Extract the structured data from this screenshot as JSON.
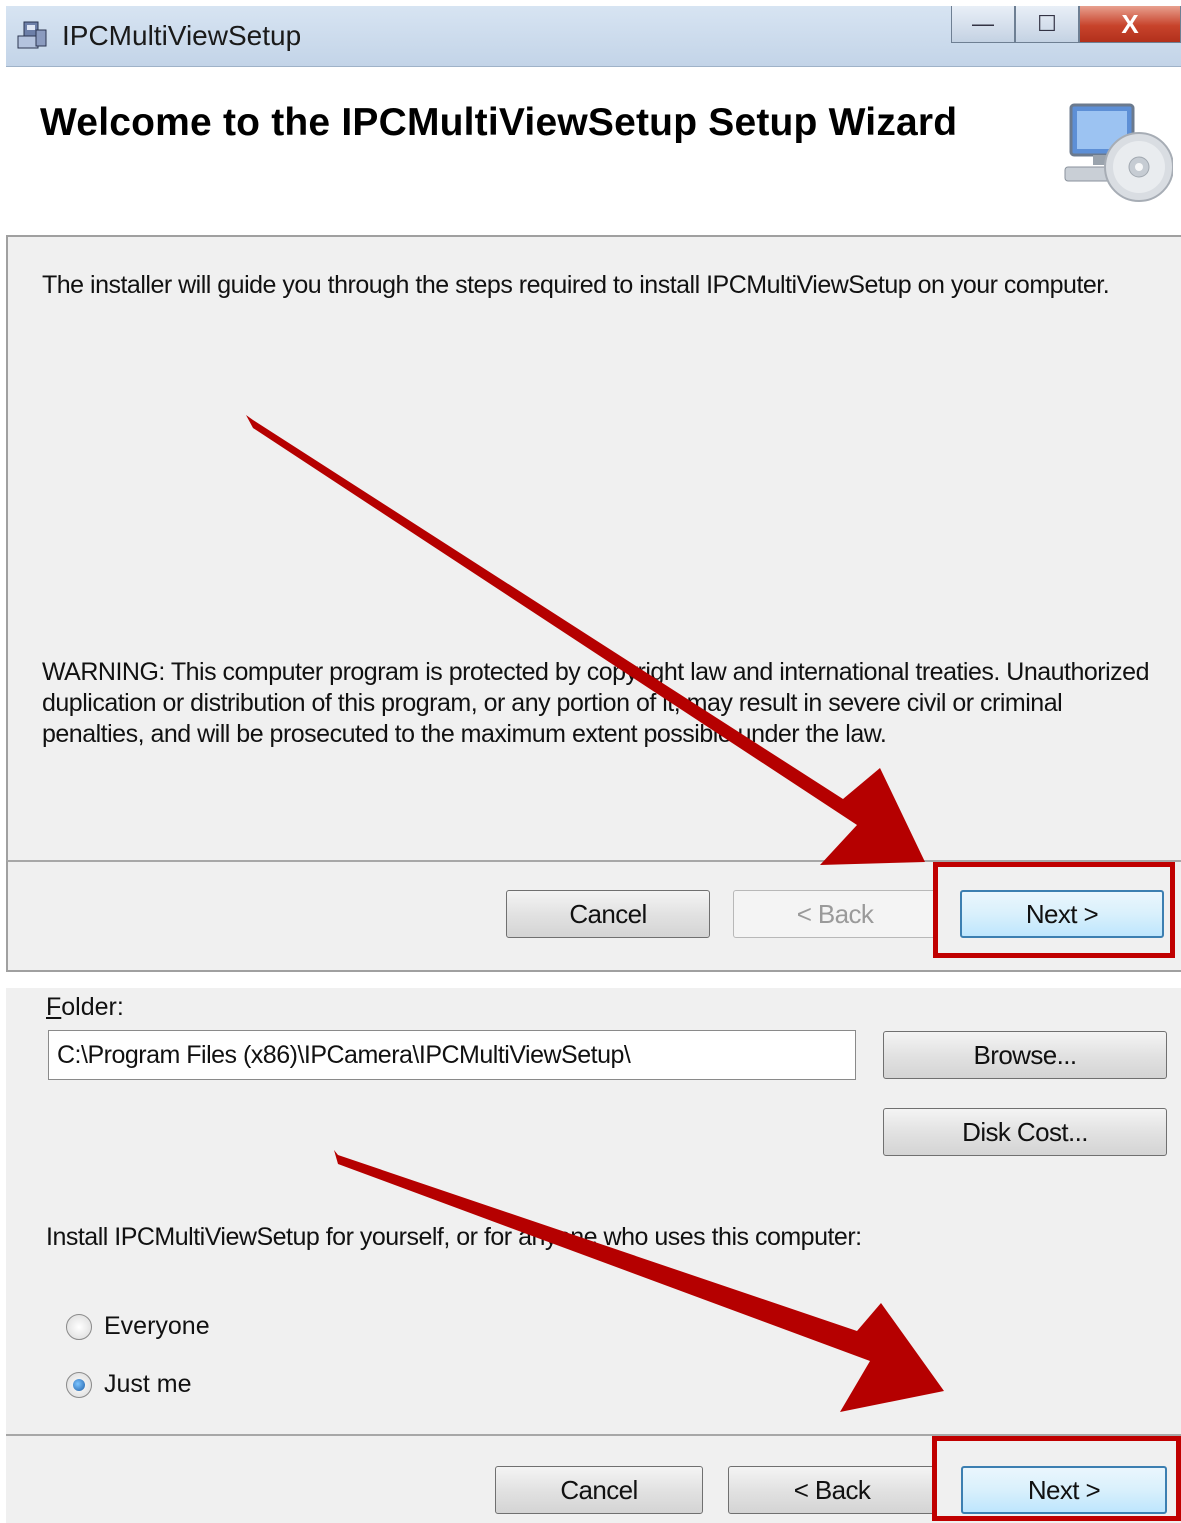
{
  "window1": {
    "title": "IPCMultiViewSetup",
    "caption_buttons": {
      "minimize": "—",
      "maximize": "☐",
      "close": "X"
    },
    "wizard_title": "Welcome to the IPCMultiViewSetup Setup Wizard",
    "intro": "The installer will guide you through the steps required to install IPCMultiViewSetup on your computer.",
    "warning": "WARNING: This computer program is protected by copyright law and international treaties. Unauthorized duplication or distribution of this program, or any portion of it, may result in severe civil or criminal penalties, and will be prosecuted to the maximum extent possible under the law.",
    "buttons": {
      "cancel": "Cancel",
      "back": "< Back",
      "next": "Next >"
    }
  },
  "window2": {
    "folder_label_first": "F",
    "folder_label_rest": "older:",
    "folder_path": "C:\\Program Files (x86)\\IPCamera\\IPCMultiViewSetup\\",
    "browse": "Browse...",
    "disk_cost": "Disk Cost...",
    "install_for": "Install IPCMultiViewSetup for yourself, or for anyone who uses this computer:",
    "options": [
      "Everyone",
      "Just me"
    ],
    "selected_option": "Just me",
    "buttons": {
      "cancel": "Cancel",
      "back": "< Back",
      "next": "Next >"
    }
  },
  "colors": {
    "highlight": "#c00000",
    "arrow": "#b00000",
    "dialog_bg": "#f0f0f0"
  },
  "icons": [
    "installer-app-icon",
    "computer-cd-icon",
    "red-arrow-annotation"
  ]
}
